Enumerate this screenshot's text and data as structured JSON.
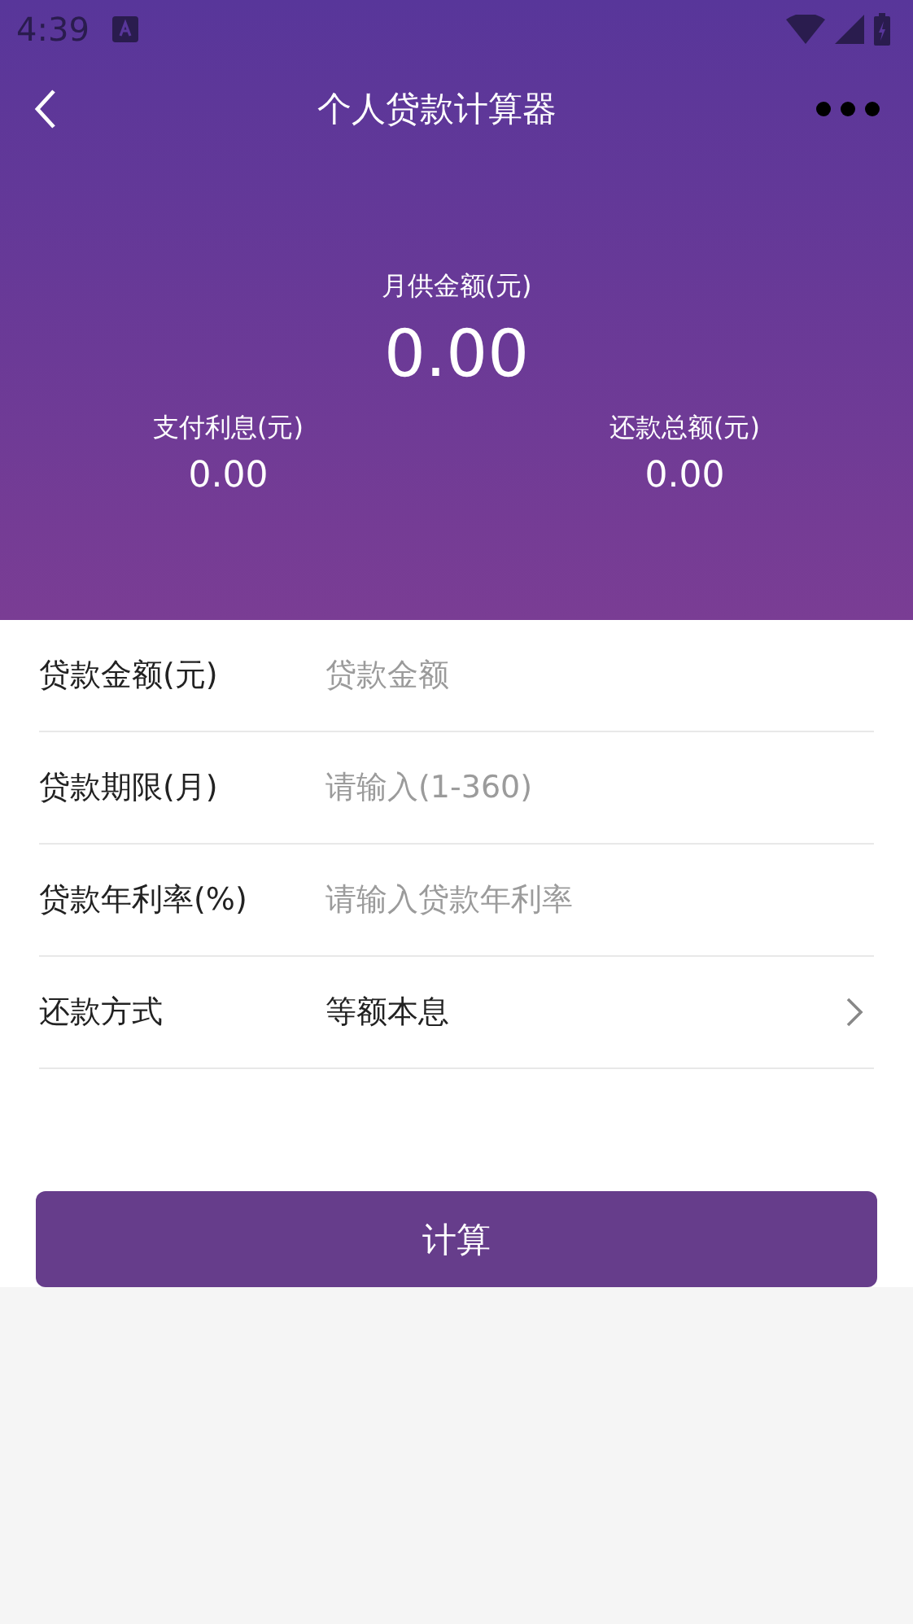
{
  "status_bar": {
    "time": "4:39"
  },
  "app_bar": {
    "title": "个人贷款计算器"
  },
  "summary": {
    "main": {
      "label": "月供金额(元)",
      "value": "0.00"
    },
    "items": [
      {
        "label": "支付利息(元)",
        "value": "0.00"
      },
      {
        "label": "还款总额(元)",
        "value": "0.00"
      }
    ]
  },
  "form": [
    {
      "kind": "input",
      "label": "贷款金额(元)",
      "placeholder": "贷款金额"
    },
    {
      "kind": "input",
      "label": "贷款期限(月)",
      "placeholder": "请输入(1-360)"
    },
    {
      "kind": "input",
      "label": "贷款年利率(%)",
      "placeholder": "请输入贷款年利率"
    },
    {
      "kind": "select",
      "label": "还款方式",
      "value": "等额本息"
    }
  ],
  "button": "计算"
}
